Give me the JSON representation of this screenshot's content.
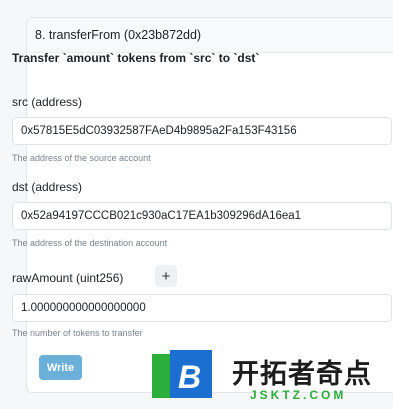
{
  "function": {
    "header": "8. transferFrom (0x23b872dd)",
    "description": "Transfer `amount` tokens from `src` to `dst`"
  },
  "params": {
    "src_label": "src (address)",
    "src_value": "0x57815E5dC03932587FAeD4b9895a2Fa153F43156",
    "src_hint": "The address of the source account",
    "dst_label": "dst (address)",
    "dst_value": "0x52a94197CCCB021c930aC17EA1b309296dA16ea1",
    "dst_hint": "The address of the destination account",
    "amount_label": "rawAmount (uint256)",
    "amount_add": "+",
    "amount_value": "1.000000000000000000",
    "amount_hint": "The number of tokens to transfer"
  },
  "actions": {
    "write_label": "Write"
  },
  "watermark": {
    "logo_letter": "B",
    "title": "开拓者奇点",
    "url": "JSKTZ.COM"
  },
  "colors": {
    "accent": "#6ab0d8",
    "logo_green": "#2cae3c",
    "logo_blue": "#1a6fd1"
  }
}
